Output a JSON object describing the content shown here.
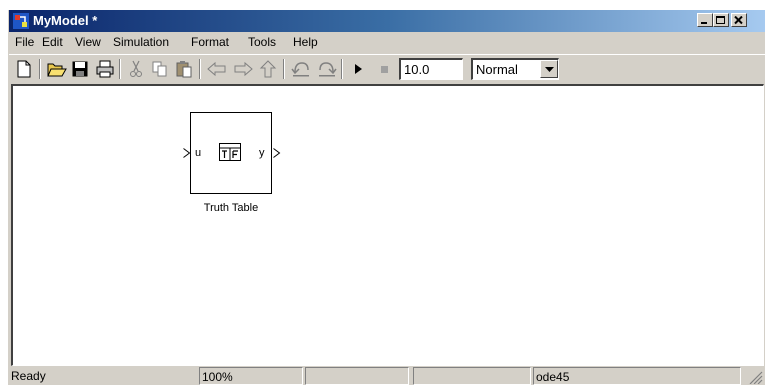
{
  "window": {
    "title": "MyModel *"
  },
  "menu": [
    "File",
    "Edit",
    "View",
    "Simulation",
    "Format",
    "Tools",
    "Help"
  ],
  "toolbar": {
    "icons": [
      "new-file-icon",
      "open-folder-icon",
      "save-icon",
      "print-icon",
      "cut-icon",
      "copy-icon",
      "paste-icon",
      "back-arrow-icon",
      "forward-arrow-icon",
      "up-arrow-icon",
      "undo-icon",
      "redo-icon",
      "play-icon",
      "stop-icon"
    ],
    "stop_time": "10.0",
    "sim_mode": "Normal"
  },
  "model": {
    "block_name": "Truth Table",
    "input_port": "u",
    "output_port": "y"
  },
  "status": {
    "state": "Ready",
    "zoom": "100%",
    "solver": "ode45"
  }
}
